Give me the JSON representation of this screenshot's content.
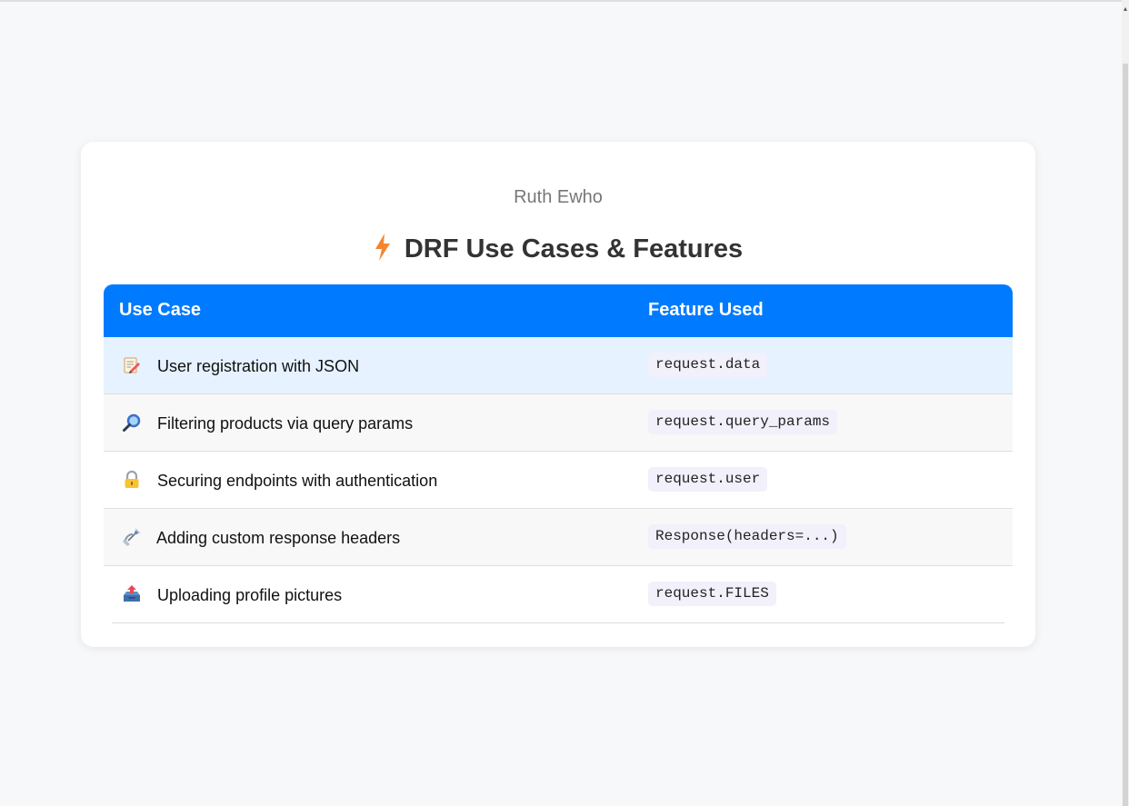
{
  "author": "Ruth Ewho",
  "title": "DRF Use Cases & Features",
  "colors": {
    "header_bg": "#007bff",
    "highlight_row": "#e6f2ff",
    "bolt": "#f5862e"
  },
  "table": {
    "headers": [
      "Use Case",
      "Feature Used"
    ],
    "rows": [
      {
        "icon": "memo-icon",
        "use_case": "User registration with JSON",
        "feature": "request.data"
      },
      {
        "icon": "magnifier-icon",
        "use_case": "Filtering products via query params",
        "feature": "request.query_params"
      },
      {
        "icon": "lock-icon",
        "use_case": "Securing endpoints with authentication",
        "feature": "request.user"
      },
      {
        "icon": "satellite-icon",
        "use_case": "Adding custom response headers",
        "feature": "Response(headers=...)"
      },
      {
        "icon": "outbox-icon",
        "use_case": "Uploading profile pictures",
        "feature": "request.FILES"
      }
    ]
  }
}
